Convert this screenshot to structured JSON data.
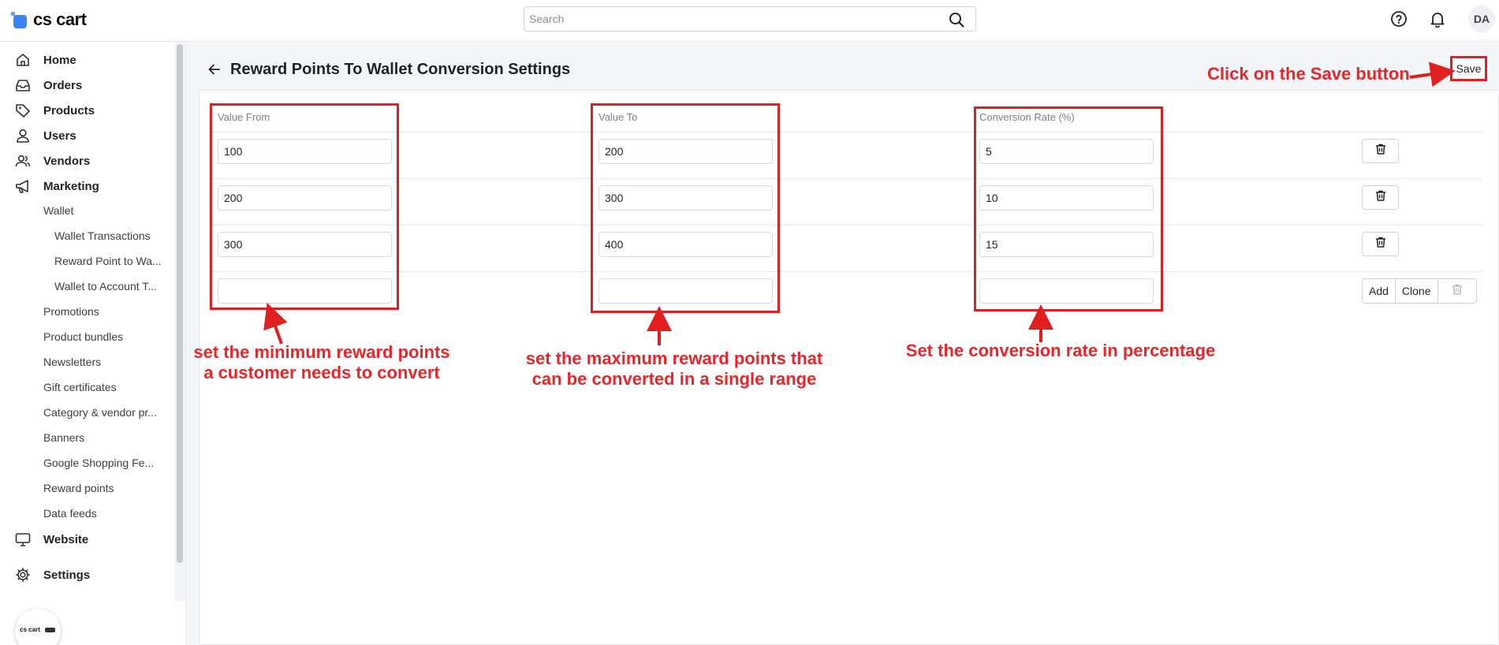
{
  "header": {
    "logo_text": "cs cart",
    "search_placeholder": "Search",
    "avatar_initials": "DA",
    "icons": [
      "help-icon",
      "bell-icon"
    ]
  },
  "sidebar": {
    "items": [
      {
        "label": "Home",
        "icon": "home-icon"
      },
      {
        "label": "Orders",
        "icon": "inbox-icon"
      },
      {
        "label": "Products",
        "icon": "tag-icon"
      },
      {
        "label": "Users",
        "icon": "user-icon"
      },
      {
        "label": "Vendors",
        "icon": "users-icon"
      },
      {
        "label": "Marketing",
        "icon": "megaphone-icon"
      },
      {
        "label": "Website",
        "icon": "monitor-icon"
      },
      {
        "label": "Settings",
        "icon": "gear-icon"
      }
    ],
    "marketing_sub": [
      "Wallet",
      "Promotions",
      "Product bundles",
      "Newsletters",
      "Gift certificates",
      "Category & vendor pr...",
      "Banners",
      "Google Shopping Fe...",
      "Reward points",
      "Data feeds"
    ],
    "wallet_sub": [
      "Wallet Transactions",
      "Reward Point to Wa...",
      "Wallet to Account T..."
    ],
    "mini_logo_text": "cs cart"
  },
  "page": {
    "title": "Reward Points To Wallet Conversion Settings",
    "save_label": "Save"
  },
  "table": {
    "headers": [
      "Value From",
      "Value To",
      "Conversion Rate (%)"
    ],
    "rows": [
      {
        "from": "100",
        "to": "200",
        "rate": "5"
      },
      {
        "from": "200",
        "to": "300",
        "rate": "10"
      },
      {
        "from": "300",
        "to": "400",
        "rate": "15"
      },
      {
        "from": "",
        "to": "",
        "rate": ""
      }
    ],
    "add_label": "Add",
    "clone_label": "Clone"
  },
  "annotations": {
    "save": "Click on the Save button",
    "from_line1": "set the minimum reward points",
    "from_line2": "a customer needs to convert",
    "to_line1": "set the maximum reward points that",
    "to_line2": "can be converted in a single range",
    "rate": "Set the conversion rate in percentage",
    "color": "#e02020"
  }
}
